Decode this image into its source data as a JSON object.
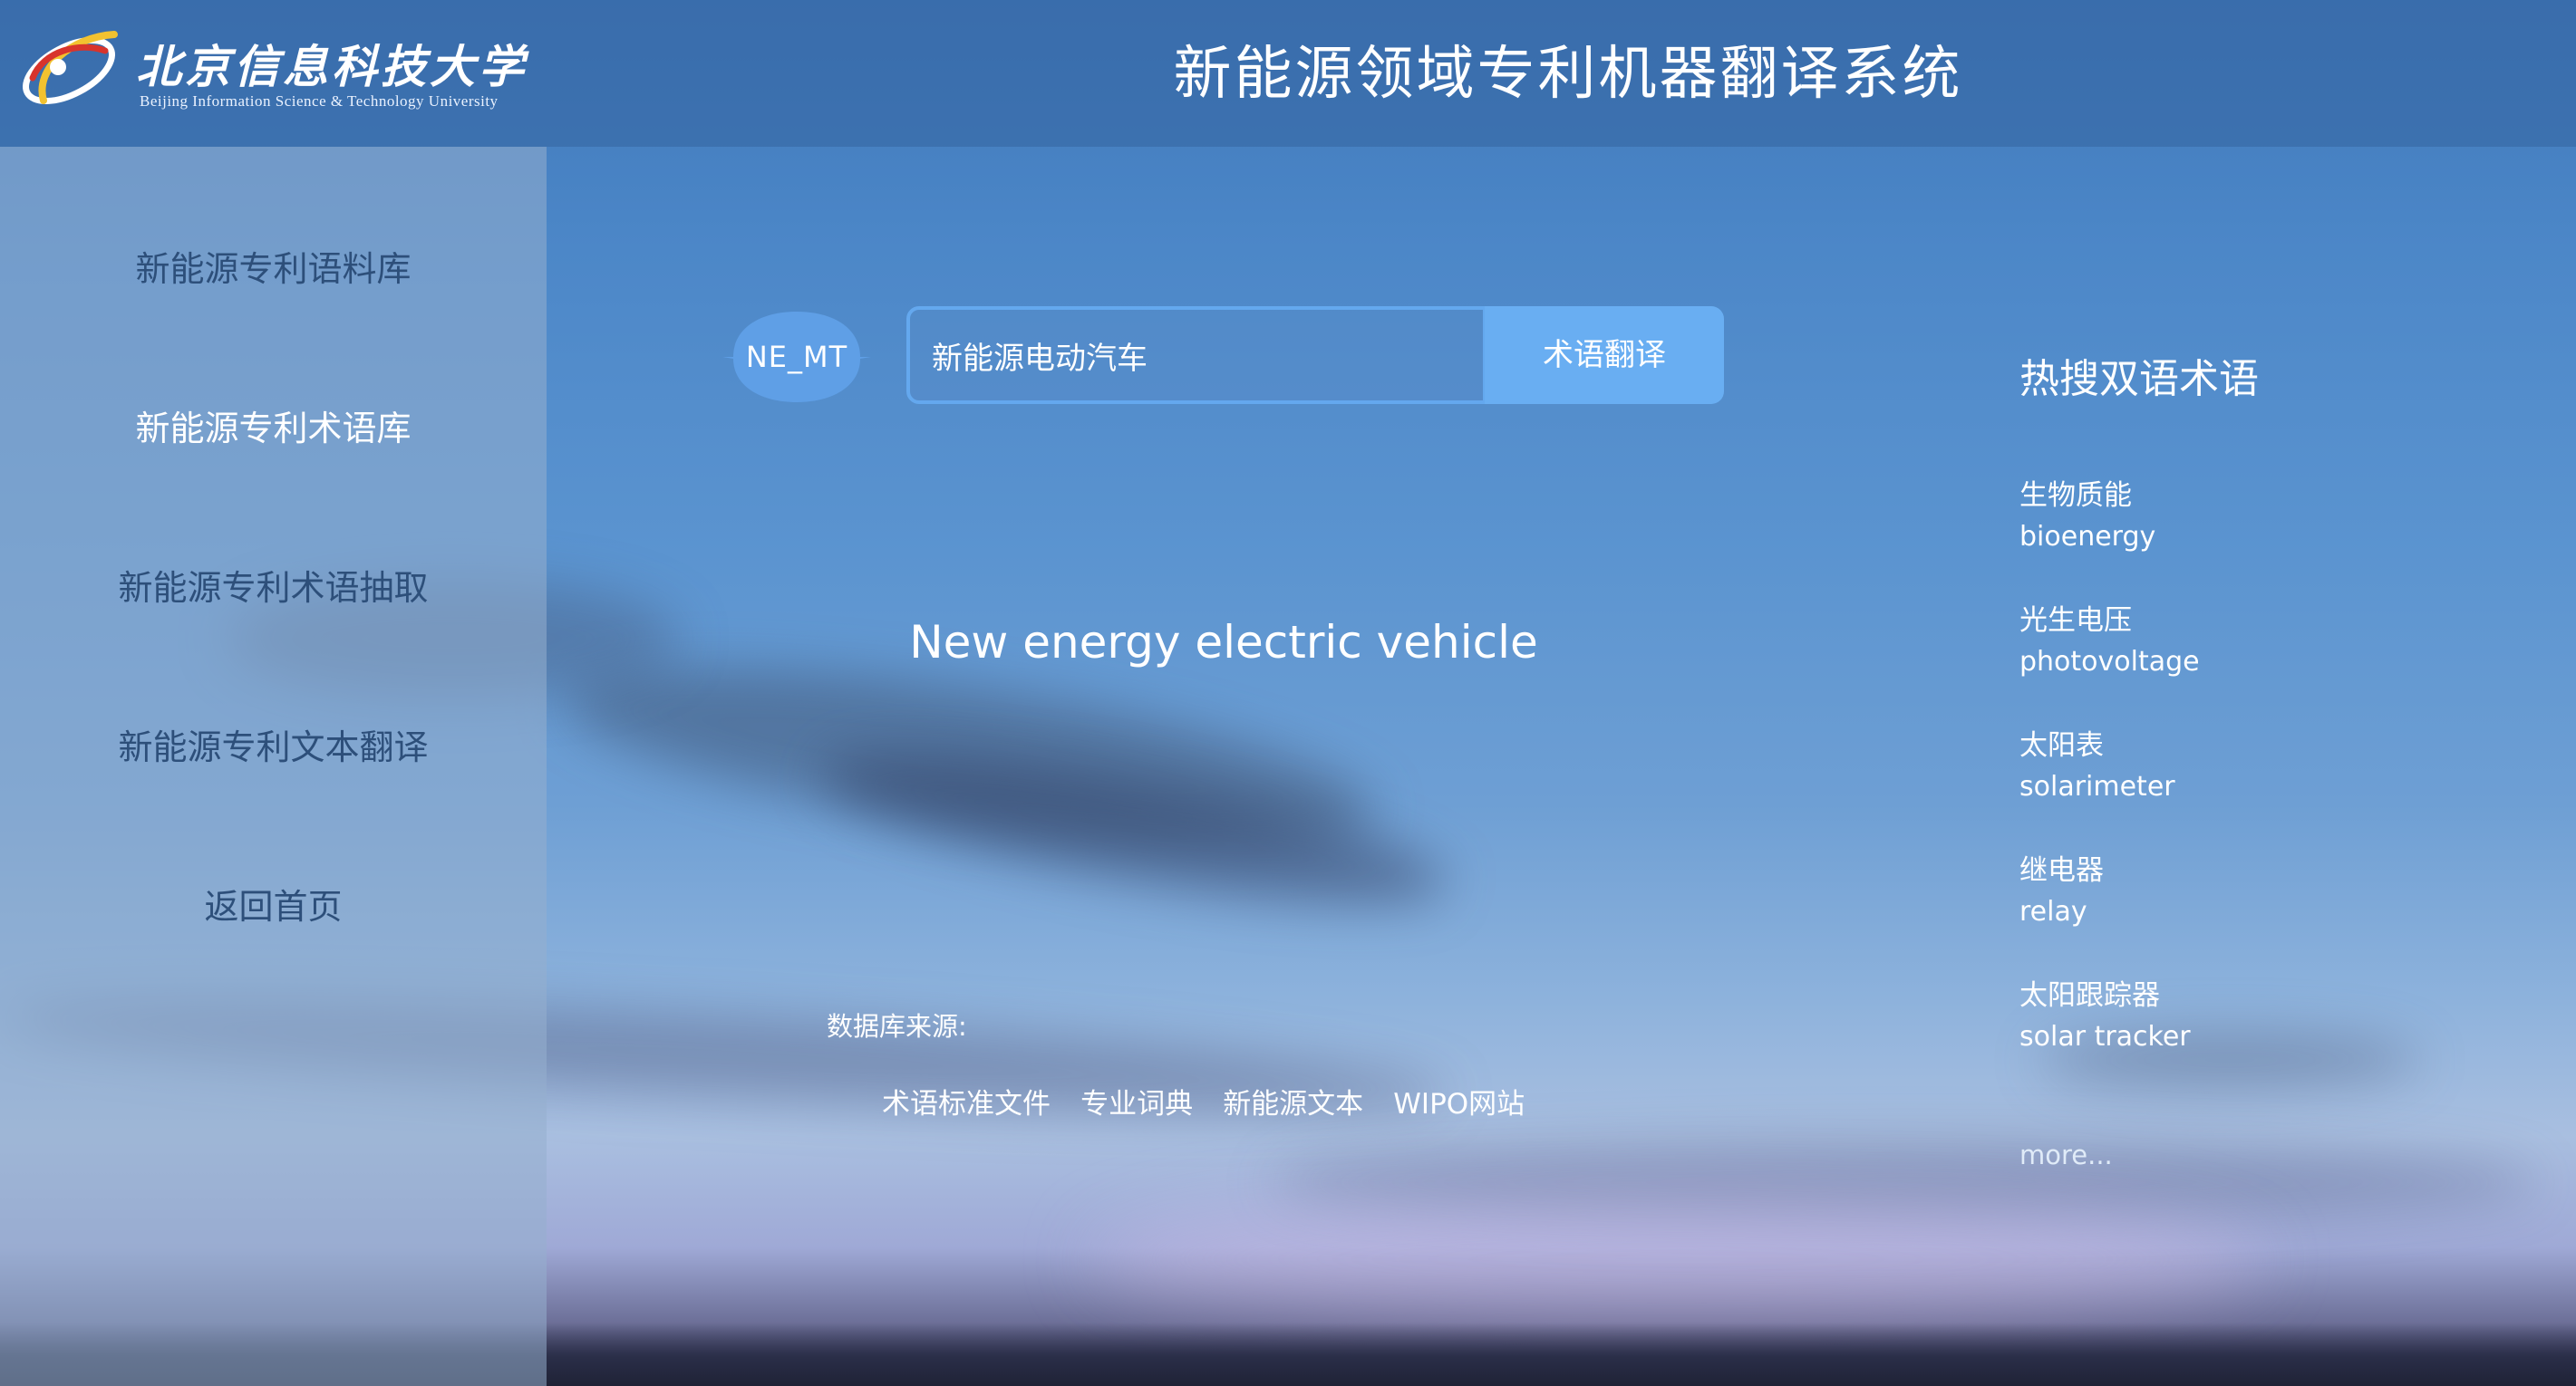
{
  "header": {
    "university_cn": "北京信息科技大学",
    "university_en": "Beijing Information Science & Technology University",
    "app_title": "新能源领域专利机器翻译系统"
  },
  "sidebar": {
    "items": [
      {
        "label": "新能源专利语料库",
        "active": false
      },
      {
        "label": "新能源专利术语库",
        "active": true
      },
      {
        "label": "新能源专利术语抽取",
        "active": false
      },
      {
        "label": "新能源专利文本翻译",
        "active": false
      },
      {
        "label": "返回首页",
        "active": false
      }
    ]
  },
  "search": {
    "badge": "NE_MT",
    "value": "新能源电动汽车",
    "button_label": "术语翻译"
  },
  "result": {
    "text": "New energy electric vehicle"
  },
  "database": {
    "label": "数据库来源:",
    "sources": [
      "术语标准文件",
      "专业词典",
      "新能源文本",
      "WIPO网站"
    ]
  },
  "hot_terms": {
    "title": "热搜双语术语",
    "items": [
      {
        "cn": "生物质能",
        "en": "bioenergy"
      },
      {
        "cn": "光生电压",
        "en": "photovoltage"
      },
      {
        "cn": "太阳表",
        "en": "solarimeter"
      },
      {
        "cn": "继电器",
        "en": "relay"
      },
      {
        "cn": "太阳跟踪器",
        "en": "solar tracker"
      }
    ],
    "more_label": "more..."
  },
  "colors": {
    "header_bg": "#3464a0",
    "sidebar_bg": "#96afcd",
    "sidebar_text": "#2d4f7a",
    "accent": "#69aef2",
    "text": "#ffffff"
  }
}
